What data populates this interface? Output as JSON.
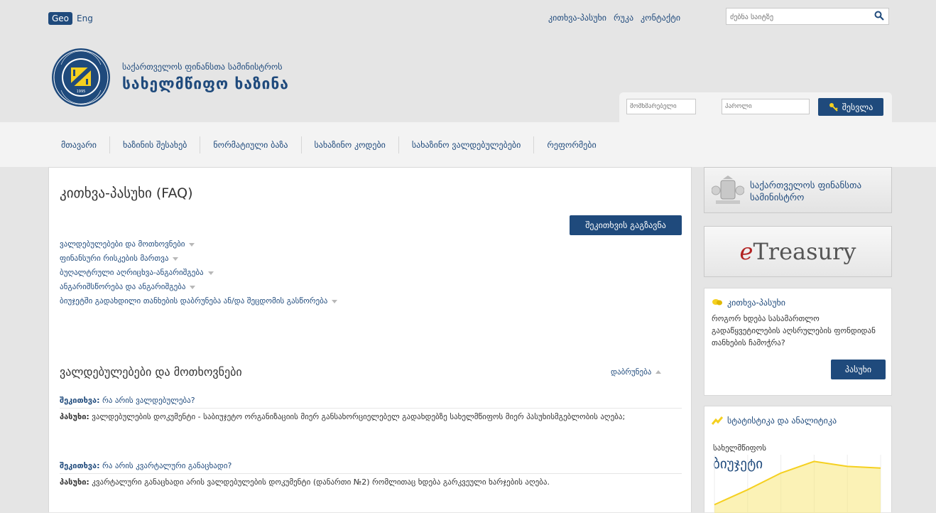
{
  "topbar": {
    "lang_geo": "Geo",
    "lang_eng": "Eng",
    "links": [
      "კითხვა-პასუხი",
      "რუკა",
      "კონტაქტი"
    ],
    "search_placeholder": "ძებნა საიტზე"
  },
  "header": {
    "brand_sub": "საქართველოს ფინანსთა სამინისტროს",
    "brand_title": "სახელმწიფო ხაზინა",
    "logo_year": "1995"
  },
  "login": {
    "username_placeholder": "მომხმარებელი",
    "password_placeholder": "პაროლი",
    "submit_label": "შესვლა"
  },
  "nav": {
    "items": [
      "მთავარი",
      "ხაზინის შესახებ",
      "ნორმატიული ბაზა",
      "სახაზინო კოდები",
      "სახაზინო ვალდებულებები",
      "რეფორმები"
    ]
  },
  "main": {
    "title": "კითხვა-პასუხი (FAQ)",
    "ask_button": "შეკითხვის გაგზავნა",
    "categories": [
      "ვალდებულებები და მოთხოვნები",
      "ფინანსური რისკების მართვა",
      "ბუღალტრული აღრიცხვა-ანგარიშგება",
      "ანგარიშსწორება და ანგარიშგება",
      "ბიუჯეტში გადახდილი თანხების დაბრუნება ან/და შეცდომის გასწორება"
    ],
    "section_title": "ვალდებულებები და მოთხოვნები",
    "back_label": "დაბრუნება",
    "qa": [
      {
        "q_label": "შეკითხვა:",
        "q_text": " რა არის ვალდებულება?",
        "a_label": "პასუხი:",
        "a_text": " ვალდებულების დოკუმენტი - საბიუჯეტო ორგანიზაციის მიერ განსახორციელებელ გადახდებზე სახელმწიფოს მიერ პასუხისმგებლობის აღება;"
      },
      {
        "q_label": "შეკითხვა:",
        "q_text": " რა არის კვარტალური განაცხადი?",
        "a_label": "პასუხი:",
        "a_text": " კვარტალური განაცხადი არის ვალდებულების დოკუმენტი (დანართი №2) რომლითაც ხდება გარკვეული ხარჯების აღება."
      }
    ]
  },
  "sidebar": {
    "ministry_banner": "საქართველოს ფინანსთა სამინისტრო",
    "etreasury_e": "e",
    "etreasury_rest": "Treasury",
    "faq": {
      "heading": "კითხვა-პასუხი",
      "question": "როგორ ხდება სასამართლო გადაწყვეტილების აღსრულების ფონდიდან თანხების ჩამოჭრა?",
      "answer_button": "პასუხი"
    },
    "stats": {
      "heading": "სტატისტიკა და ანალიტიკა",
      "label": "სახელმწიფოს",
      "big": "ბიუჯეტი",
      "series": [
        10,
        28,
        48,
        62,
        56,
        54
      ]
    }
  },
  "colors": {
    "brand": "#1f4a7c",
    "accent_yellow": "#f5d020"
  }
}
